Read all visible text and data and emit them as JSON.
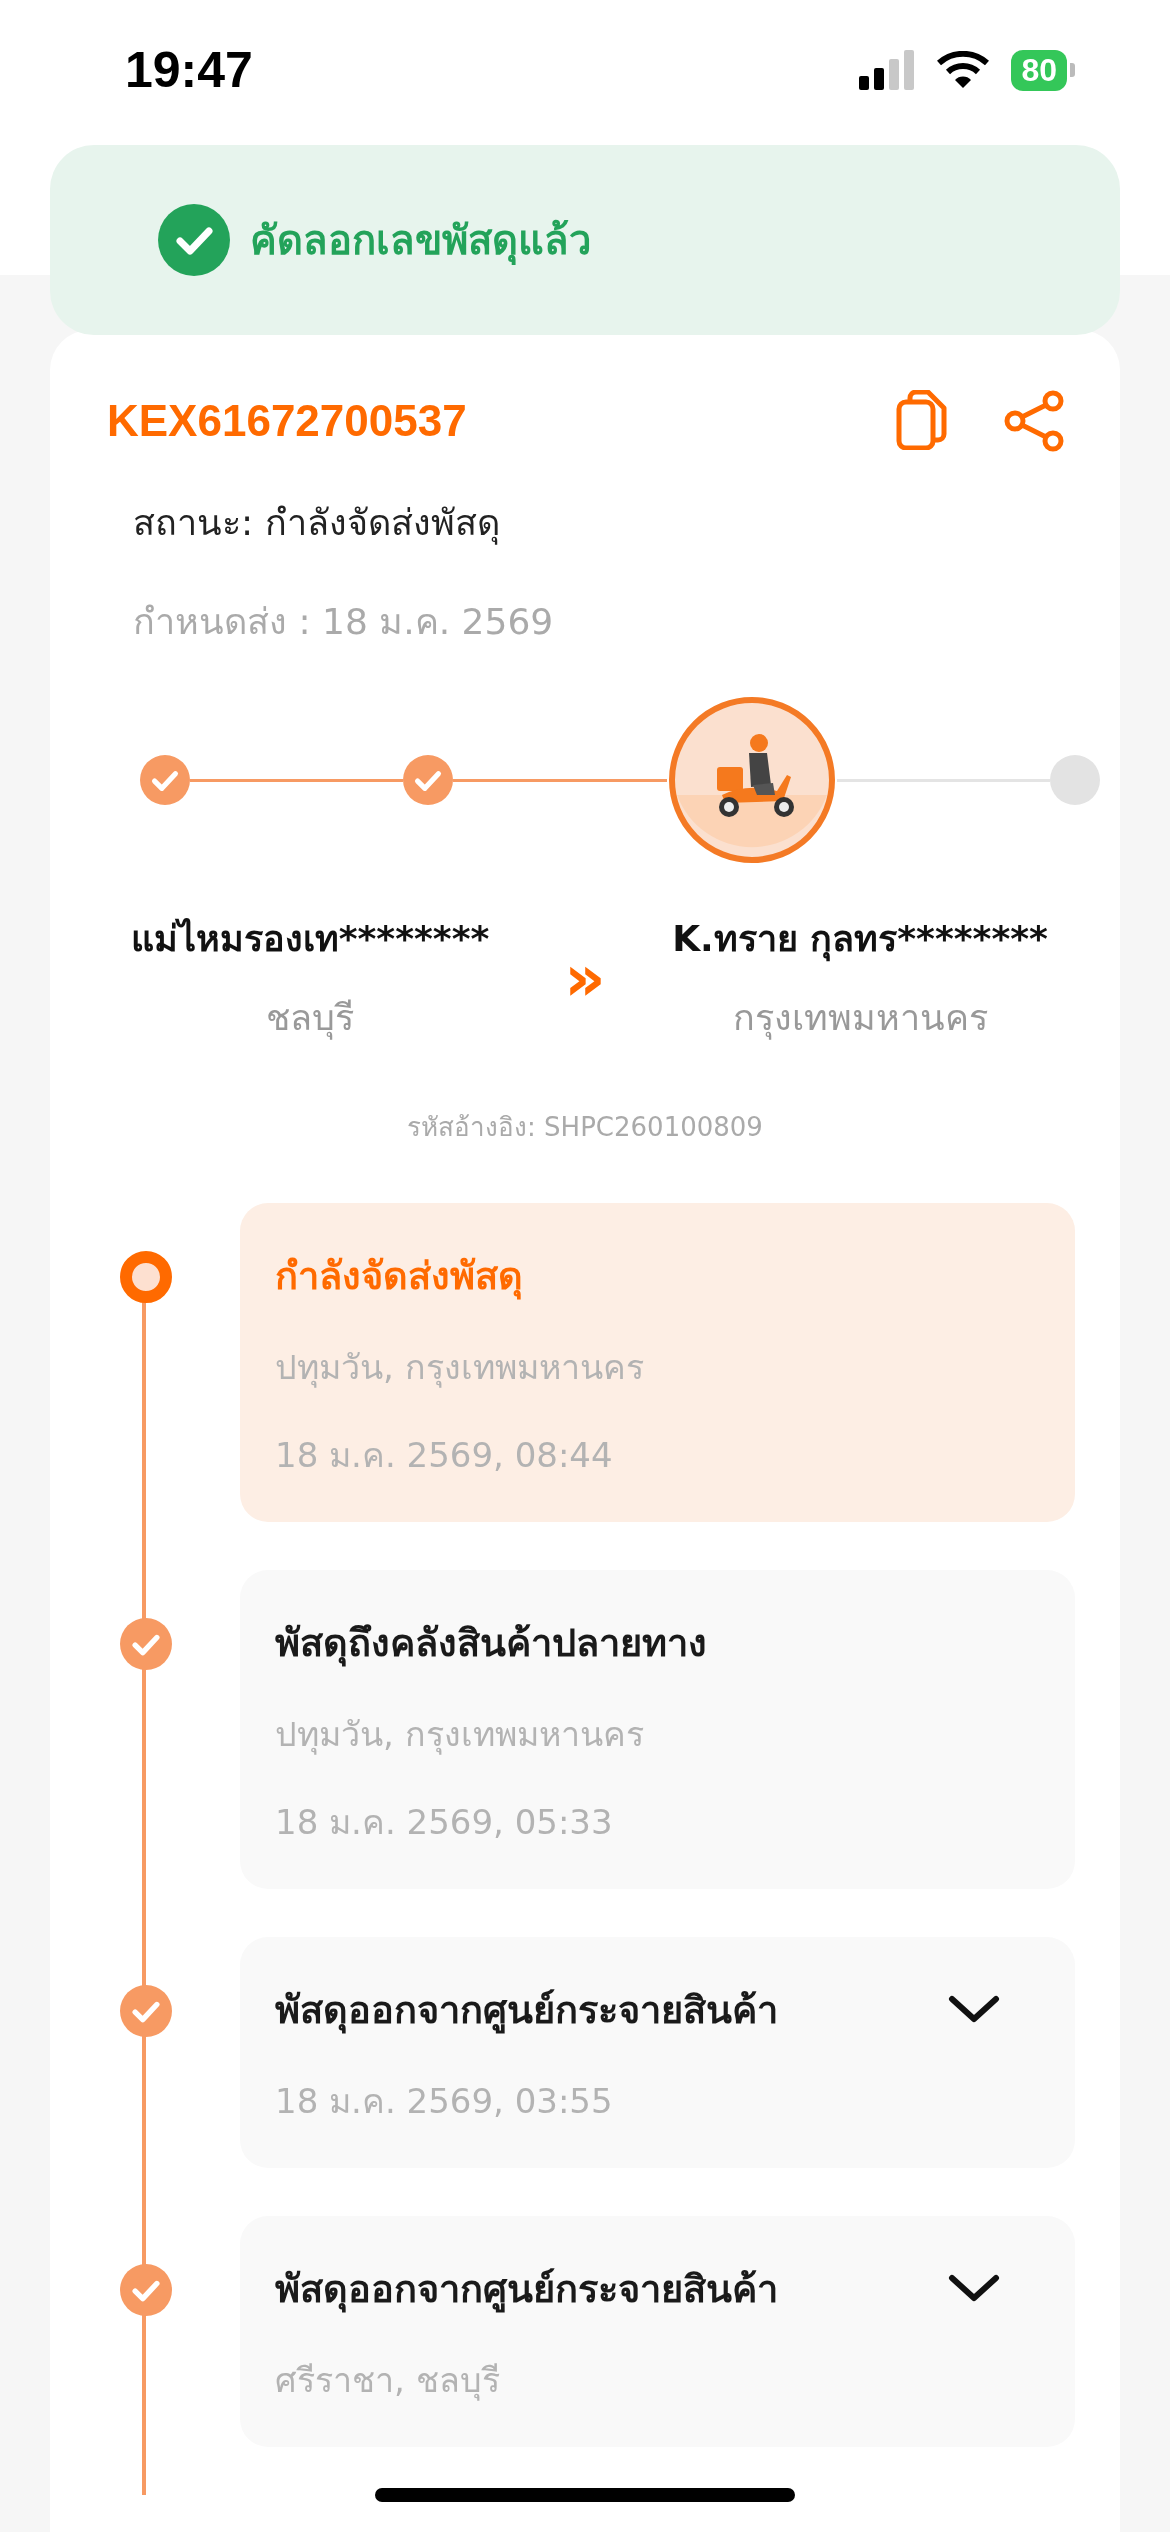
{
  "status_bar": {
    "time": "19:47",
    "battery": "80"
  },
  "toast": {
    "message": "คัดลอกเลขพัสดุแล้ว"
  },
  "parcel": {
    "tracking_number": "KEX61672700537",
    "status": "สถานะ: กำลังจัดส่งพัสดุ",
    "due": "กำหนดส่ง : 18 ม.ค. 2569",
    "progress": [
      {
        "kind": "done"
      },
      {
        "kind": "done"
      },
      {
        "kind": "current"
      },
      {
        "kind": "pending"
      }
    ],
    "sender": {
      "name": "แม่ไหมรองเท********",
      "province": "ชลบุรี"
    },
    "arrow": "»",
    "receiver": {
      "name": "K.ทราย กุลทร********",
      "province": "กรุงเทพมหานคร"
    },
    "reference": "รหัสอ้างอิง: SHPC260100809"
  },
  "events": [
    {
      "kind": "current",
      "title": "กำลังจัดส่งพัสดุ",
      "location": "ปทุมวัน, กรุงเทพมหานคร",
      "time": "18 ม.ค. 2569, 08:44",
      "expandable": false
    },
    {
      "kind": "done",
      "title": "พัสดุถึงคลังสินค้าปลายทาง",
      "location": "ปทุมวัน, กรุงเทพมหานคร",
      "time": "18 ม.ค. 2569, 05:33",
      "expandable": false
    },
    {
      "kind": "done",
      "title": "พัสดุออกจากศูนย์กระจายสินค้า",
      "time": "18 ม.ค. 2569, 03:55",
      "expandable": true
    },
    {
      "kind": "done",
      "title": "พัสดุออกจากศูนย์กระจายสินค้า",
      "location": "ศรีราชา, ชลบุรี",
      "expandable": true
    }
  ]
}
